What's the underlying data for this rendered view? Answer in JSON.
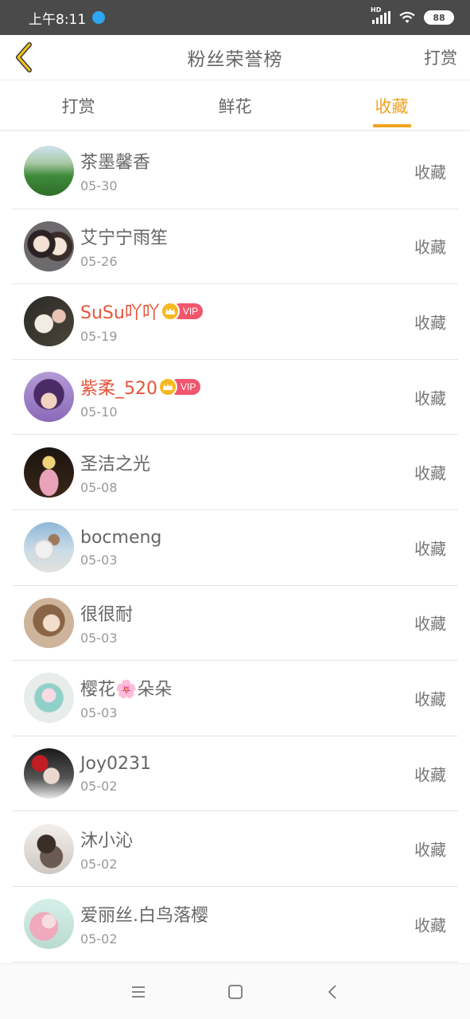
{
  "status_bar": {
    "time": "上午8:11",
    "network": "HD",
    "battery": "88"
  },
  "header": {
    "title": "粉丝荣誉榜",
    "action": "打赏"
  },
  "tabs": [
    {
      "label": "打赏",
      "active": false
    },
    {
      "label": "鲜花",
      "active": false
    },
    {
      "label": "收藏",
      "active": true
    }
  ],
  "accent_color": "#f0a21e",
  "vip_name_color": "#e4543a",
  "vip_label": "VIP",
  "list": [
    {
      "name": "茶墨馨香",
      "date": "05-30",
      "action": "收藏",
      "vip": false
    },
    {
      "name": "艾宁宁雨笙",
      "date": "05-26",
      "action": "收藏",
      "vip": false
    },
    {
      "name": "SuSu吖吖",
      "date": "05-19",
      "action": "收藏",
      "vip": true
    },
    {
      "name": "紫柔_520",
      "date": "05-10",
      "action": "收藏",
      "vip": true
    },
    {
      "name": "圣洁之光",
      "date": "05-08",
      "action": "收藏",
      "vip": false
    },
    {
      "name": "bocmeng",
      "date": "05-03",
      "action": "收藏",
      "vip": false
    },
    {
      "name": "很很耐",
      "date": "05-03",
      "action": "收藏",
      "vip": false
    },
    {
      "name": "樱花🌸朵朵",
      "date": "05-03",
      "action": "收藏",
      "vip": false
    },
    {
      "name": "Joy0231",
      "date": "05-02",
      "action": "收藏",
      "vip": false
    },
    {
      "name": "沐小沁",
      "date": "05-02",
      "action": "收藏",
      "vip": false
    },
    {
      "name": "爱丽丝.白鸟落樱",
      "date": "05-02",
      "action": "收藏",
      "vip": false
    }
  ]
}
